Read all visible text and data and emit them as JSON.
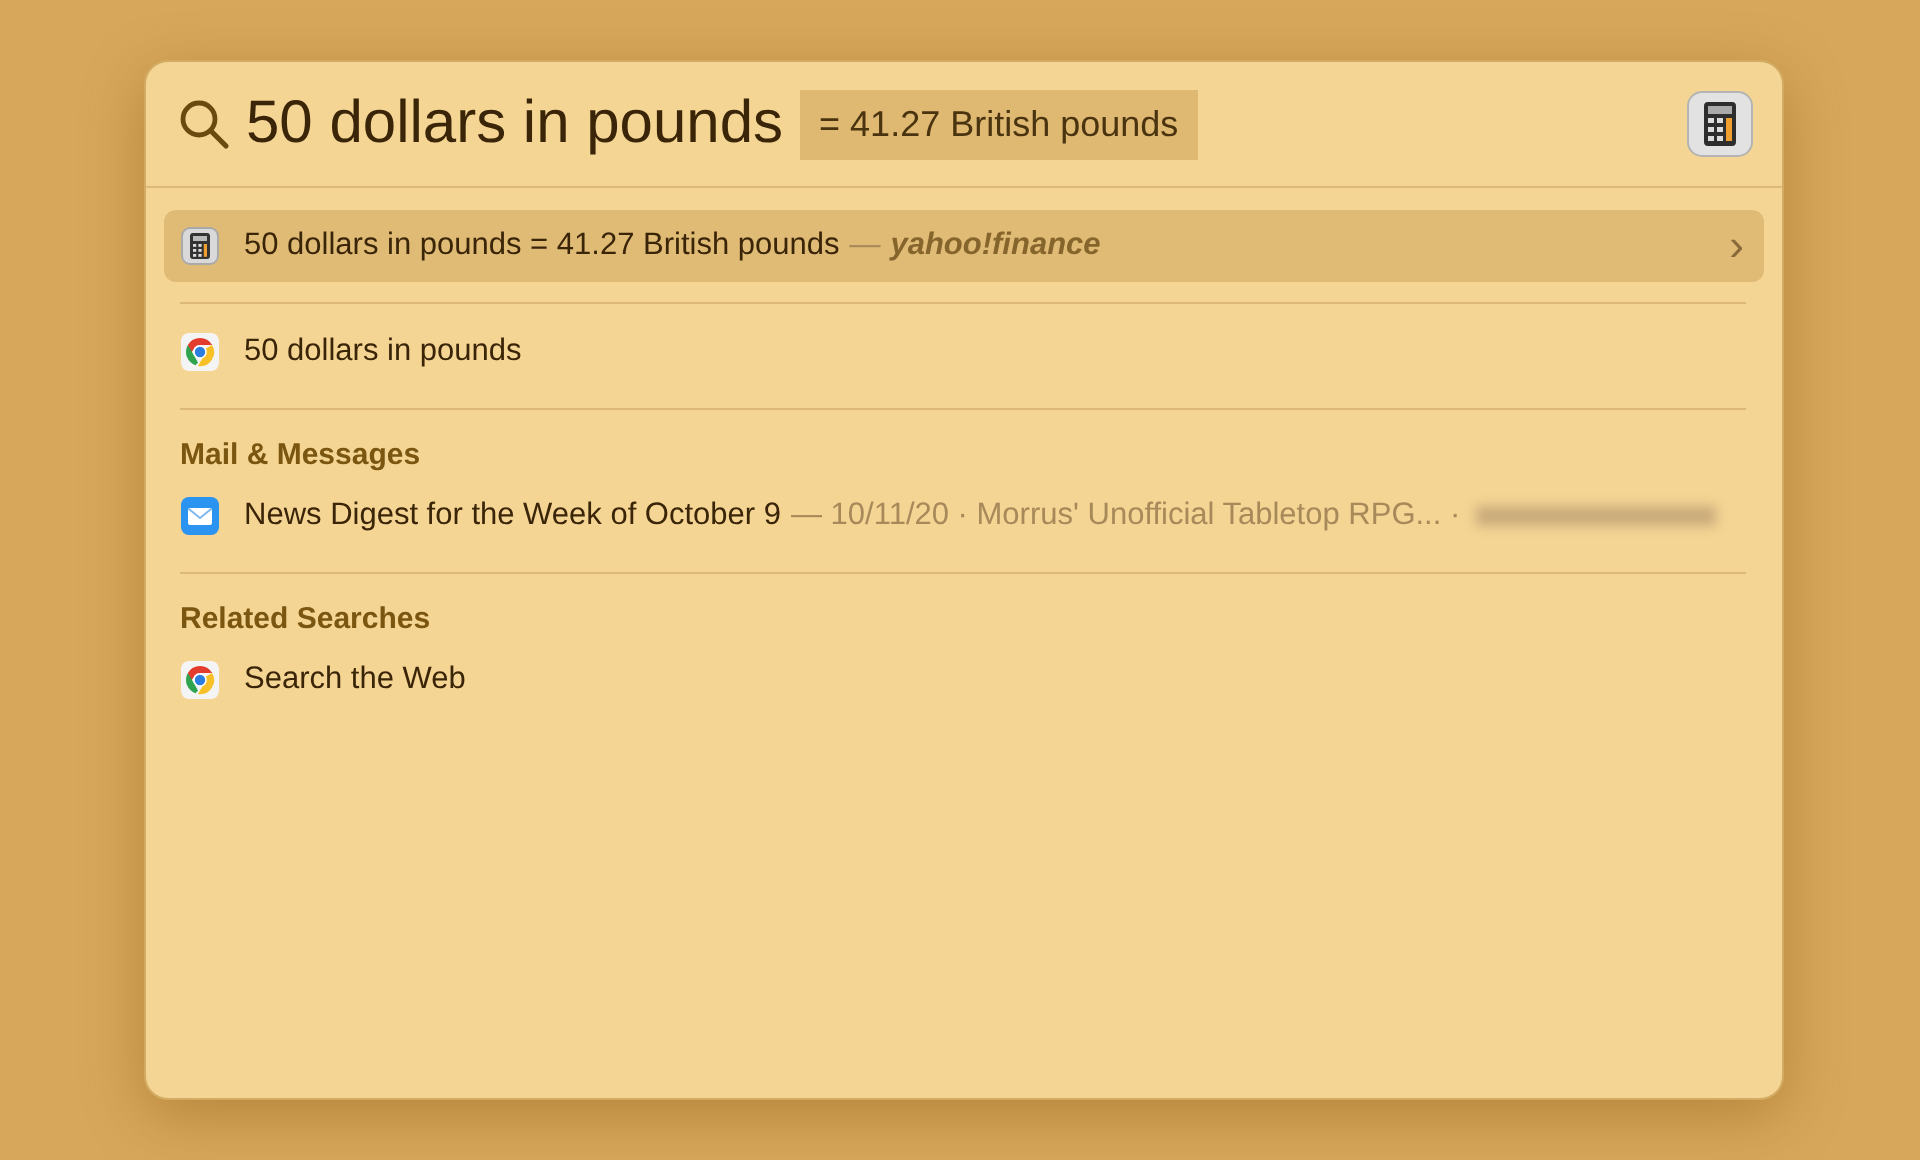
{
  "search": {
    "query": "50 dollars in pounds",
    "completion": "= 41.27 British pounds"
  },
  "groups": [
    {
      "items": [
        {
          "kind": "calc",
          "title": "50 dollars in pounds = 41.27 British pounds",
          "detail": "—",
          "source": "yahoo!finance",
          "chevron": "›",
          "selected": true
        }
      ]
    },
    {
      "items": [
        {
          "kind": "web",
          "title": "50 dollars in pounds",
          "selected": false
        }
      ]
    },
    {
      "title": "Mail & Messages",
      "items": [
        {
          "kind": "mail",
          "title": "News Digest for the Week of October 9",
          "detail": "— 10/11/20 · Morrus' Unofficial Tabletop RPG... ·",
          "redacted": true,
          "selected": false
        }
      ]
    },
    {
      "title": "Related Searches",
      "items": [
        {
          "kind": "web",
          "title": "Search the Web",
          "selected": false
        }
      ]
    }
  ]
}
